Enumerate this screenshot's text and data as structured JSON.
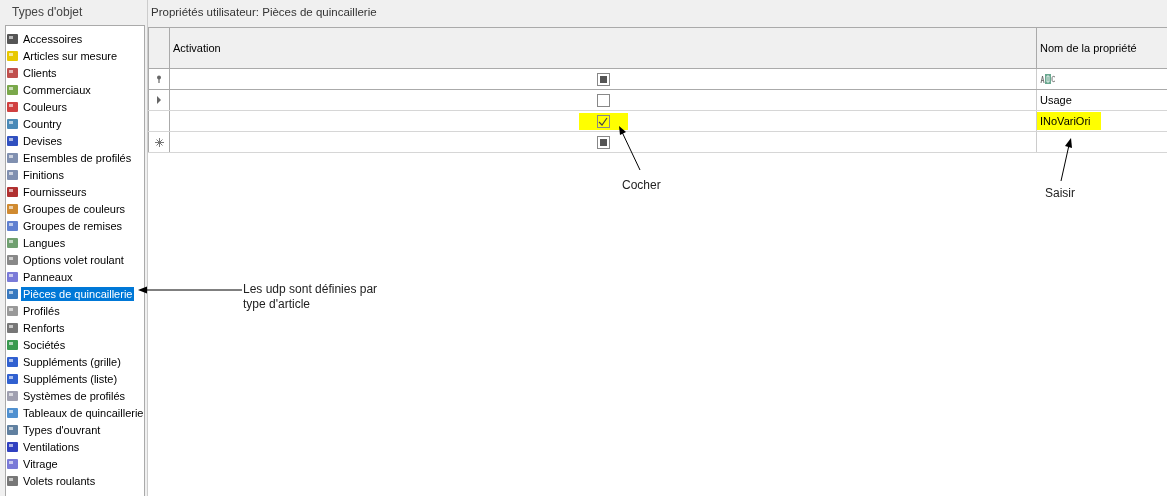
{
  "sidebar": {
    "title": "Types d'objet",
    "items": [
      {
        "label": "Accessoires",
        "selected": false
      },
      {
        "label": "Articles sur mesure",
        "selected": false
      },
      {
        "label": "Clients",
        "selected": false
      },
      {
        "label": "Commerciaux",
        "selected": false
      },
      {
        "label": "Couleurs",
        "selected": false
      },
      {
        "label": "Country",
        "selected": false
      },
      {
        "label": "Devises",
        "selected": false
      },
      {
        "label": "Ensembles de profilés",
        "selected": false
      },
      {
        "label": "Finitions",
        "selected": false
      },
      {
        "label": "Fournisseurs",
        "selected": false
      },
      {
        "label": "Groupes de couleurs",
        "selected": false
      },
      {
        "label": "Groupes de remises",
        "selected": false
      },
      {
        "label": "Langues",
        "selected": false
      },
      {
        "label": "Options volet roulant",
        "selected": false
      },
      {
        "label": "Panneaux",
        "selected": false
      },
      {
        "label": "Pièces de quincaillerie",
        "selected": true
      },
      {
        "label": "Profilés",
        "selected": false
      },
      {
        "label": "Renforts",
        "selected": false
      },
      {
        "label": "Sociétés",
        "selected": false
      },
      {
        "label": "Suppléments (grille)",
        "selected": false
      },
      {
        "label": "Suppléments (liste)",
        "selected": false
      },
      {
        "label": "Systèmes de profilés",
        "selected": false
      },
      {
        "label": "Tableaux de quincaillerie",
        "selected": false
      },
      {
        "label": "Types d'ouvrant",
        "selected": false
      },
      {
        "label": "Ventilations",
        "selected": false
      },
      {
        "label": "Vitrage",
        "selected": false
      },
      {
        "label": "Volets roulants",
        "selected": false
      }
    ]
  },
  "panel": {
    "title": "Propriétés utilisateur: Pièces de quincaillerie"
  },
  "table": {
    "columns": [
      "Activation",
      "Nom de la propriété"
    ],
    "rows": [
      {
        "kind": "filter",
        "indeterminate": true
      },
      {
        "kind": "data",
        "current": true,
        "checked": false,
        "name": "Usage",
        "highlighted": false
      },
      {
        "kind": "data",
        "current": false,
        "checked": true,
        "name": "INoVariOri",
        "highlighted": true
      },
      {
        "kind": "new",
        "indeterminate": true
      }
    ]
  },
  "annotations": [
    {
      "kind": "sidebar",
      "text": "Les udp sont définies par type d'article"
    },
    {
      "kind": "checkbox",
      "text": "Cocher"
    },
    {
      "kind": "name",
      "text": "Saisir"
    }
  ]
}
